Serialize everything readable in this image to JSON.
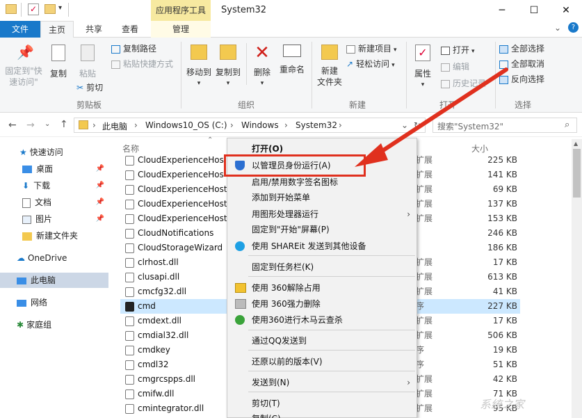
{
  "titlebar": {
    "context_tab": "应用程序工具",
    "title": "System32",
    "minimize": "─",
    "maximize": "☐",
    "close": "✕",
    "help": "?"
  },
  "tabs": {
    "file": "文件",
    "home": "主页",
    "share": "共享",
    "view": "查看",
    "manage": "管理"
  },
  "ribbon": {
    "pin_quick": "固定到\"快",
    "pin_quick2": "速访问\"",
    "copy": "复制",
    "paste": "粘贴",
    "copy_path": "复制路径",
    "paste_shortcut": "粘贴快捷方式",
    "cut": "剪切",
    "group_clipboard": "剪贴板",
    "move_to": "移动到",
    "copy_to": "复制到",
    "delete": "删除",
    "rename": "重命名",
    "group_organize": "组织",
    "new_folder": "新建",
    "new_folder2": "文件夹",
    "new_item": "新建项目",
    "easy_access": "轻松访问",
    "group_new": "新建",
    "properties": "属性",
    "open": "打开",
    "edit": "编辑",
    "history": "历史记录",
    "group_open": "打开",
    "select_all": "全部选择",
    "select_none": "全部取消",
    "invert": "反向选择",
    "group_select": "选择"
  },
  "address": {
    "crumbs": [
      "此电脑",
      "Windows10_OS (C:)",
      "Windows",
      "System32"
    ],
    "search_placeholder": "搜索\"System32\""
  },
  "nav": {
    "items": [
      "快速访问",
      "桌面",
      "下载",
      "文档",
      "图片",
      "新建文件夹",
      "OneDrive",
      "此电脑",
      "网络",
      "家庭组"
    ]
  },
  "columns": {
    "name": "名称",
    "size": "大小"
  },
  "files": [
    {
      "name": "CloudExperienceHos",
      "type": "扩展",
      "size": "225 KB"
    },
    {
      "name": "CloudExperienceHos",
      "type": "扩展",
      "size": "141 KB"
    },
    {
      "name": "CloudExperienceHostB",
      "type": "扩展",
      "size": "69 KB"
    },
    {
      "name": "CloudExperienceHostC",
      "type": "扩展",
      "size": "137 KB"
    },
    {
      "name": "CloudExperienceHostU",
      "type": "扩展",
      "size": "153 KB"
    },
    {
      "name": "CloudNotifications",
      "type": "",
      "size": "246 KB"
    },
    {
      "name": "CloudStorageWizard",
      "type": "",
      "size": "186 KB"
    },
    {
      "name": "clrhost.dll",
      "type": "扩展",
      "size": "17 KB"
    },
    {
      "name": "clusapi.dll",
      "type": "扩展",
      "size": "613 KB"
    },
    {
      "name": "cmcfg32.dll",
      "type": "扩展",
      "size": "41 KB"
    },
    {
      "name": "cmd",
      "type": "序",
      "size": "227 KB"
    },
    {
      "name": "cmdext.dll",
      "type": "扩展",
      "size": "17 KB"
    },
    {
      "name": "cmdial32.dll",
      "type": "扩展",
      "size": "506 KB"
    },
    {
      "name": "cmdkey",
      "type": "序",
      "size": "19 KB"
    },
    {
      "name": "cmdl32",
      "type": "序",
      "size": "51 KB"
    },
    {
      "name": "cmgrcspps.dll",
      "type": "扩展",
      "size": "42 KB"
    },
    {
      "name": "cmifw.dll",
      "type": "扩展",
      "size": "71 KB"
    },
    {
      "name": "cmintegrator.dll",
      "type": "扩展",
      "size": "95 KB"
    }
  ],
  "context_menu": {
    "open": "打开(O)",
    "run_as_admin": "以管理员身份运行(A)",
    "toggle_signature": "启用/禁用数字签名图标",
    "add_start": "添加到开始菜单",
    "run_gpu": "用图形处理器运行",
    "pin_start": "固定到\"开始\"屏幕(P)",
    "shareit": "使用 SHAREit 发送到其他设备",
    "pin_taskbar": "固定到任务栏(K)",
    "unlock_360": "使用 360解除占用",
    "force_delete_360": "使用 360强力删除",
    "scan_360": "使用360进行木马云查杀",
    "send_qq": "通过QQ发送到",
    "restore_prev": "还原以前的版本(V)",
    "send_to": "发送到(N)",
    "cut": "剪切(T)",
    "copy": "复制(C)"
  },
  "watermark": "系统之家",
  "colors": {
    "accent": "#1979ca",
    "highlight": "#e0301e",
    "context_tab": "#f7e9a0",
    "selection": "#cce8ff"
  }
}
